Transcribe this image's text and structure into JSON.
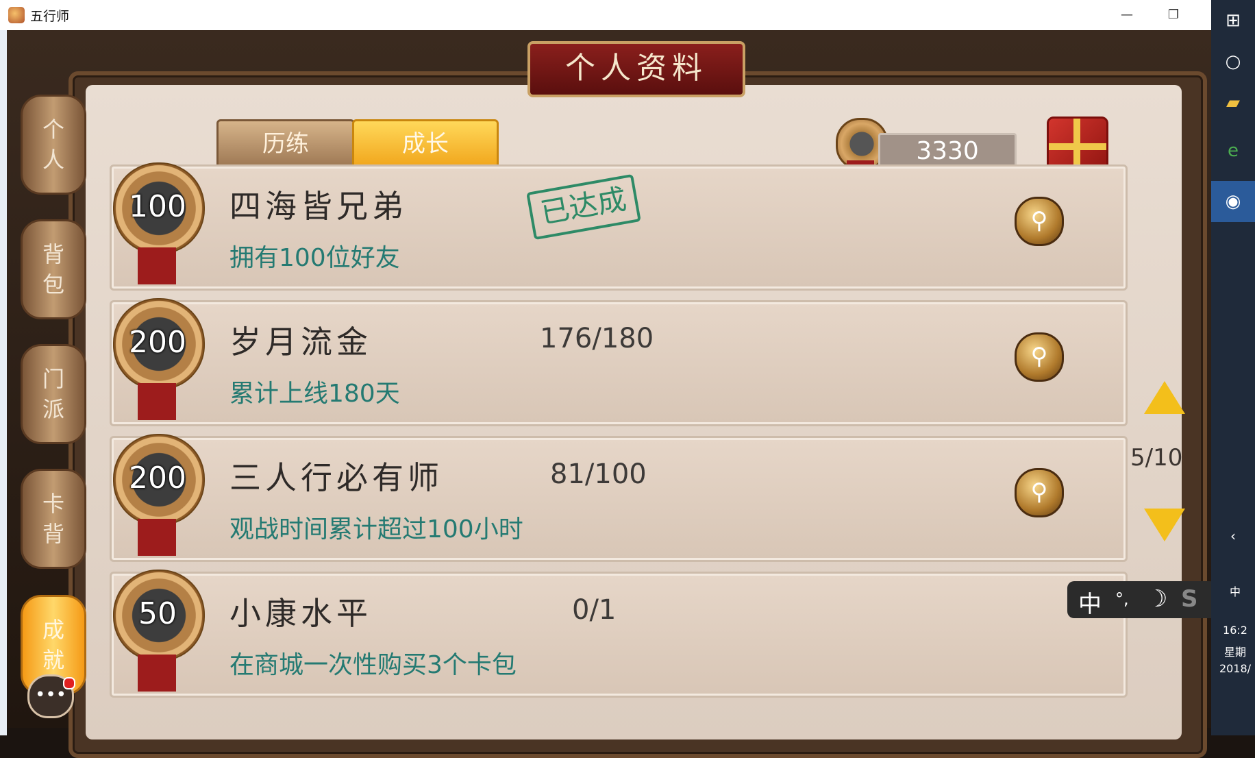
{
  "window": {
    "title": "五行师",
    "min": "—",
    "max": "❐"
  },
  "header": {
    "title": "个人资料"
  },
  "side_tabs": [
    {
      "label": "个人"
    },
    {
      "label": "背包"
    },
    {
      "label": "门派"
    },
    {
      "label": "卡背"
    },
    {
      "label": "成就"
    }
  ],
  "tabs": [
    {
      "label": "历练"
    },
    {
      "label": "成长"
    }
  ],
  "currency": {
    "value": "3330"
  },
  "achievements": [
    {
      "points": "100",
      "title": "四海皆兄弟",
      "desc": "拥有100位好友",
      "progress": "",
      "status": "已达成"
    },
    {
      "points": "200",
      "title": "岁月流金",
      "desc": "累计上线180天",
      "progress": "176/180",
      "status": ""
    },
    {
      "points": "200",
      "title": "三人行必有师",
      "desc": "观战时间累计超过100小时",
      "progress": "81/100",
      "status": ""
    },
    {
      "points": "50",
      "title": "小康水平",
      "desc": "在商城一次性购买3个卡包",
      "progress": "0/1",
      "status": ""
    }
  ],
  "pagination": {
    "indicator": "5/10"
  },
  "ime": {
    "lang": "中",
    "punct": "°,",
    "moon": "☽",
    "logo": "S"
  },
  "taskbar": {
    "lang": "中",
    "time": "16:2",
    "weekday": "星期",
    "date": "2018/"
  },
  "colors": {
    "accent": "#f3bf1b",
    "desc": "#247a72",
    "stamp": "#2d8a66"
  }
}
